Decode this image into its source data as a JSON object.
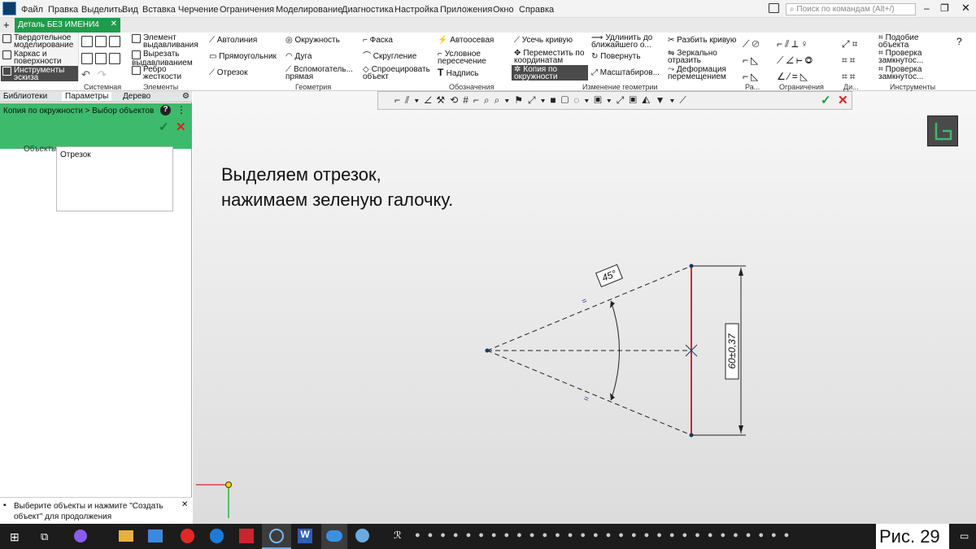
{
  "menu": [
    "Файл",
    "Правка",
    "Выделить",
    "Вид",
    "Вставка",
    "Черчение",
    "Ограничения",
    "Моделирование",
    "Диагностика",
    "Настройка",
    "Приложения",
    "Окно",
    "Справка"
  ],
  "search_placeholder": "Поиск по командам (Alt+/)",
  "doc_tab": "Деталь БЕЗ ИМЕНИ4",
  "ribbon": {
    "left": [
      "Твердотельное моделирование",
      "Каркас и поверхности",
      "Инструменты эскиза"
    ],
    "elements": [
      "Элемент выдавливания",
      "Вырезать выдавливанием",
      "Ребро жесткости"
    ],
    "geometry": [
      "Автолиния",
      "Прямоугольник",
      "Отрезок",
      "Окружность",
      "Дуга",
      "Вспомогатель... прямая",
      "Фаска",
      "Скругление",
      "Спроецировать объект"
    ],
    "notes": [
      "Автоосевая",
      "Условное пересечение",
      "Надпись"
    ],
    "edit": [
      "Усечь кривую",
      "Переместить по координатам",
      "Копия по окружности",
      "Удлинить до ближайшего о...",
      "Повернуть",
      "Масштабиров...",
      "Разбить кривую",
      "Зеркально отразить",
      "Деформация перемещением"
    ],
    "tools": [
      "Подобие объекта",
      "Проверка замкнутос...",
      "Проверка замкнутос..."
    ],
    "groups": [
      "Системная",
      "Элементы",
      "Геометрия",
      "Обозначения",
      "Изменение геометрии",
      "Ра...",
      "Ограничения",
      "Ди...",
      "Инструменты"
    ]
  },
  "panel": {
    "tabs": [
      "Библиотеки",
      "Параметры",
      "Дерево"
    ],
    "breadcrumb": "Копия по окружности > Выбор объектов",
    "objects_label": "Объекты:",
    "objects_value": "Отрезок",
    "hint": "Выберите объекты и нажмите \"Создать объект\" для продолжения"
  },
  "instruction": [
    "Выделяем отрезок,",
    "нажимаем зеленую галочку."
  ],
  "drawing": {
    "angle_dim": "45°",
    "length_dim": "60±0,37"
  },
  "caption": "Рис. 29",
  "colors": {
    "green": "#3dba6b",
    "accent": "#1f9b4b",
    "selected_line": "#e02020",
    "sketch_line": "#222"
  }
}
